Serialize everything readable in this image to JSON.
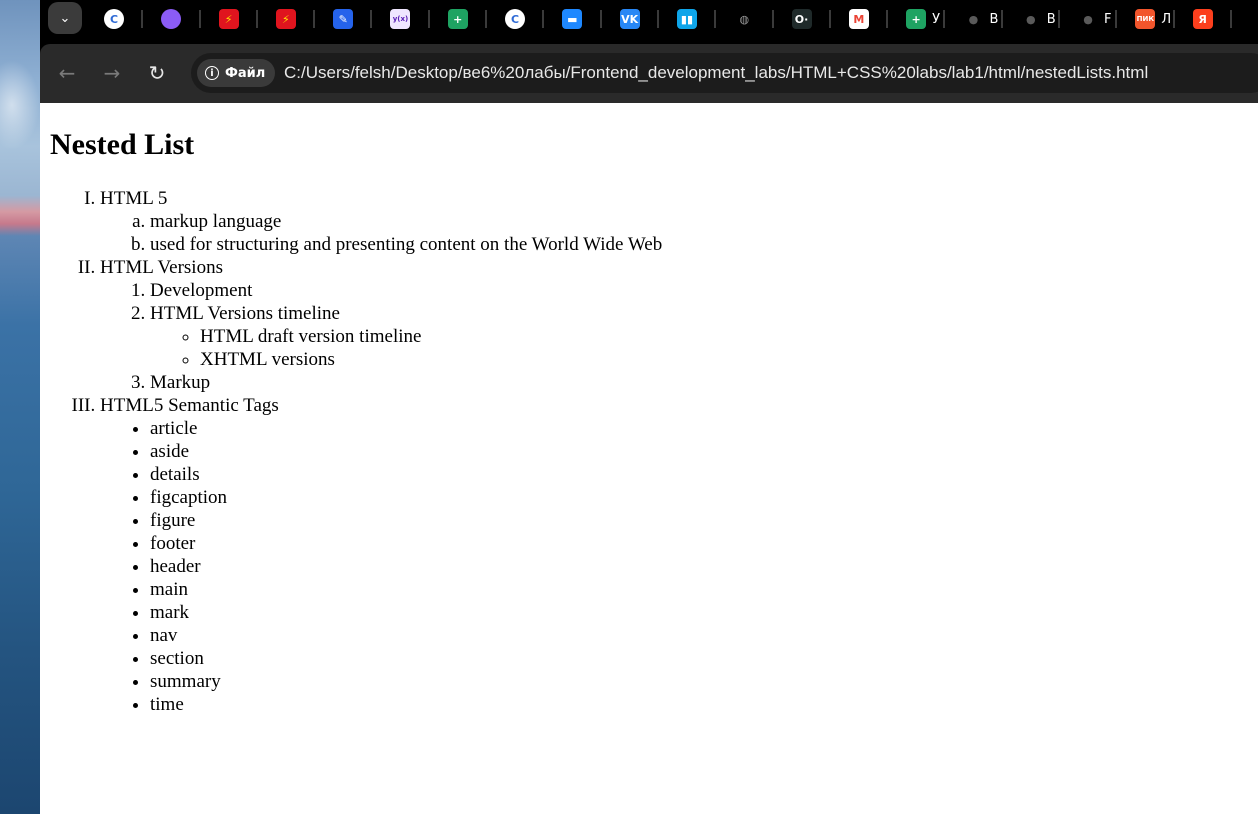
{
  "browser": {
    "tabs": [
      {
        "icon": "copyleaks-icon",
        "label": "C",
        "color": "#ffffff",
        "fg": "#2f6bd6",
        "title": ""
      },
      {
        "icon": "alice-icon",
        "label": "",
        "color": "#8b5cf6",
        "fg": "#ffffff",
        "title": ""
      },
      {
        "icon": "lightning-red-icon",
        "label": "⚡",
        "color": "#e0141e",
        "fg": "#ffe000",
        "title": ""
      },
      {
        "icon": "lightning-red-icon",
        "label": "⚡",
        "color": "#e0141e",
        "fg": "#ffe000",
        "title": ""
      },
      {
        "icon": "pencil-blue-icon",
        "label": "✎",
        "color": "#2563eb",
        "fg": "#ffffff",
        "title": ""
      },
      {
        "icon": "yfx-icon",
        "label": "y(x)",
        "color": "#efe6ff",
        "fg": "#5b21b6",
        "title": ""
      },
      {
        "icon": "google-sheets-plus-icon",
        "label": "+",
        "color": "#1ea362",
        "fg": "#ffffff",
        "title": ""
      },
      {
        "icon": "copyleaks-icon",
        "label": "C",
        "color": "#ffffff",
        "fg": "#2f6bd6",
        "title": ""
      },
      {
        "icon": "chat-bubble-icon",
        "label": "▬",
        "color": "#1e88ff",
        "fg": "#ffffff",
        "title": ""
      },
      {
        "icon": "vk-icon",
        "label": "VK",
        "color": "#2787f5",
        "fg": "#ffffff",
        "title": ""
      },
      {
        "icon": "book-stack-icon",
        "label": "▮▮",
        "color": "#0ea5e9",
        "fg": "#ffffff",
        "title": ""
      },
      {
        "icon": "globe-icon",
        "label": "◍",
        "color": "#000000",
        "fg": "#9a9a9a",
        "title": ""
      },
      {
        "icon": "codec-icon",
        "label": "O·",
        "color": "#1f2a2a",
        "fg": "#ffffff",
        "title": ""
      },
      {
        "icon": "gmail-icon",
        "label": "M",
        "color": "#ffffff",
        "fg": "#ea4335",
        "title": ""
      },
      {
        "icon": "google-sheets-plus-icon",
        "label": "+",
        "color": "#1ea362",
        "fg": "#ffffff",
        "title": "У"
      },
      {
        "icon": "github-icon",
        "label": "●",
        "color": "#000000",
        "fg": "#5a5a5a",
        "title": "В"
      },
      {
        "icon": "github-icon",
        "label": "●",
        "color": "#000000",
        "fg": "#5a5a5a",
        "title": "В"
      },
      {
        "icon": "github-icon",
        "label": "●",
        "color": "#000000",
        "fg": "#5a5a5a",
        "title": "F"
      },
      {
        "icon": "pik-icon",
        "label": "ПИК",
        "color": "#f2552c",
        "fg": "#ffffff",
        "title": "Л"
      },
      {
        "icon": "yandex-icon",
        "label": "Я",
        "color": "#fc3f1d",
        "fg": "#ffffff",
        "title": ""
      }
    ],
    "tab_search_glyph": "⌄",
    "back_glyph": "←",
    "forward_glyph": "→",
    "reload_glyph": "↻",
    "site_chip_label": "Файл",
    "url": "C:/Users/felsh/Desktop/ве6%20лабы/Frontend_development_labs/HTML+CSS%20labs/lab1/html/nestedLists.html"
  },
  "page": {
    "title": "Nested List",
    "items": [
      {
        "label": "HTML 5",
        "children": [
          "markup language",
          "used for structuring and presenting content on the World Wide Web"
        ]
      },
      {
        "label": "HTML Versions",
        "children": [
          {
            "label": "Development"
          },
          {
            "label": "HTML Versions timeline",
            "children": [
              "HTML draft version timeline",
              "XHTML versions"
            ]
          },
          {
            "label": "Markup"
          }
        ]
      },
      {
        "label": "HTML5 Semantic Tags",
        "children": [
          "article",
          "aside",
          "details",
          "figcaption",
          "figure",
          "footer",
          "header",
          "main",
          "mark",
          "nav",
          "section",
          "summary",
          "time"
        ]
      }
    ]
  }
}
